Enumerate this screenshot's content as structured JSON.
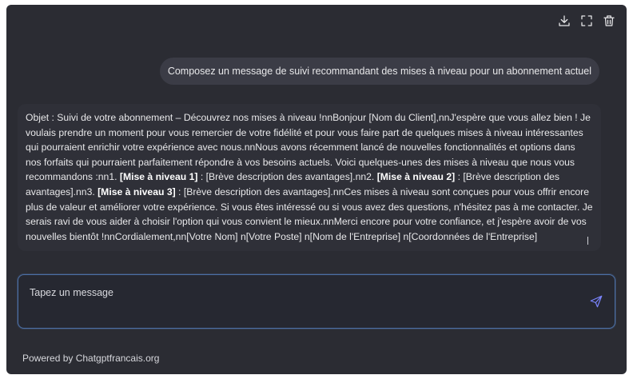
{
  "toolbar": {
    "download_icon": "download-icon",
    "fullscreen_icon": "fullscreen-icon",
    "delete_icon": "trash-icon"
  },
  "messages": {
    "user": "Composez un message de suivi recommandant des mises à niveau pour un abonnement actuel",
    "assistant": {
      "part1": "Objet : Suivi de votre abonnement – Découvrez nos mises à niveau !nnBonjour [Nom du Client],nnJ'espère que vous allez bien ! Je voulais prendre un moment pour vous remercier de votre fidélité et pour vous faire part de quelques mises à niveau intéressantes qui pourraient enrichir votre expérience avec nous.nnNous avons récemment lancé de nouvelles fonctionnalités et options dans nos forfaits qui pourraient parfaitement répondre à vos besoins actuels. Voici quelques-unes des mises à niveau que nous vous recommandons :nn1. ",
      "bold1": "[Mise à niveau 1]",
      "part2": " : [Brève description des avantages].nn2. ",
      "bold2": "[Mise à niveau 2]",
      "part3": " : [Brève description des avantages].nn3. ",
      "bold3": "[Mise à niveau 3]",
      "part4": " : [Brève description des avantages].nnCes mises à niveau sont conçues pour vous offrir encore plus de valeur et améliorer votre expérience. Si vous êtes intéressé ou si vous avez des questions, n'hésitez pas à me contacter. Je serais ravi de vous aider à choisir l'option qui vous convient le mieux.nnMerci encore pour votre confiance, et j'espère avoir de vos nouvelles bientôt !nnCordialement,nn[Votre Nom] n[Votre Poste] n[Nom de l'Entreprise] n[Coordonnées de l'Entreprise]"
    }
  },
  "composer": {
    "placeholder": "Tapez un message",
    "send_icon": "send-icon"
  },
  "footer": {
    "text": "Powered by Chatgptfrancais.org"
  },
  "colors": {
    "background": "#2b2c33",
    "user_bubble": "#3b3c46",
    "send_accent": "#7b85ff",
    "composer_border": "#4b6fa4"
  }
}
